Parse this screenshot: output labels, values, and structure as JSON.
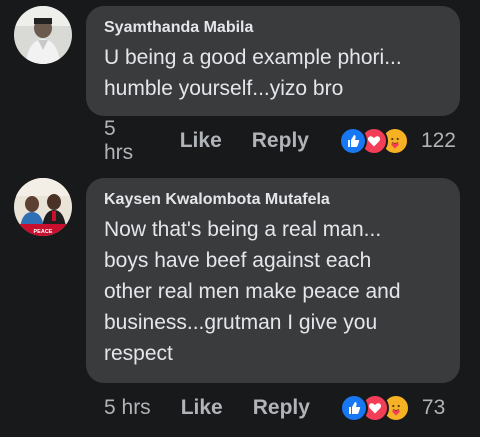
{
  "comments": [
    {
      "author": "Syamthanda Mabila",
      "lines": [
        "U being a good example phori...",
        "humble yourself...yizo bro"
      ],
      "time": "5 hrs",
      "like_label": "Like",
      "reply_label": "Reply",
      "reactions": [
        "like-icon",
        "love-icon",
        "care-icon"
      ],
      "reaction_count": "122"
    },
    {
      "author": "Kaysen Kwalombota Mutafela",
      "lines": [
        "Now that's being a real man...",
        "boys have beef against each",
        "other real men make peace and",
        "business...grutman I give you",
        "respect"
      ],
      "time": "5 hrs",
      "like_label": "Like",
      "reply_label": "Reply",
      "reactions": [
        "like-icon",
        "love-icon",
        "care-icon"
      ],
      "reaction_count": "73"
    }
  ],
  "colors": {
    "background": "#18191a",
    "bubble": "#3a3b3c",
    "text": "#e4e6eb",
    "secondary": "#b0b3b8",
    "like": "#1877f2",
    "love": "#f33e58",
    "care": "#f7b125"
  }
}
